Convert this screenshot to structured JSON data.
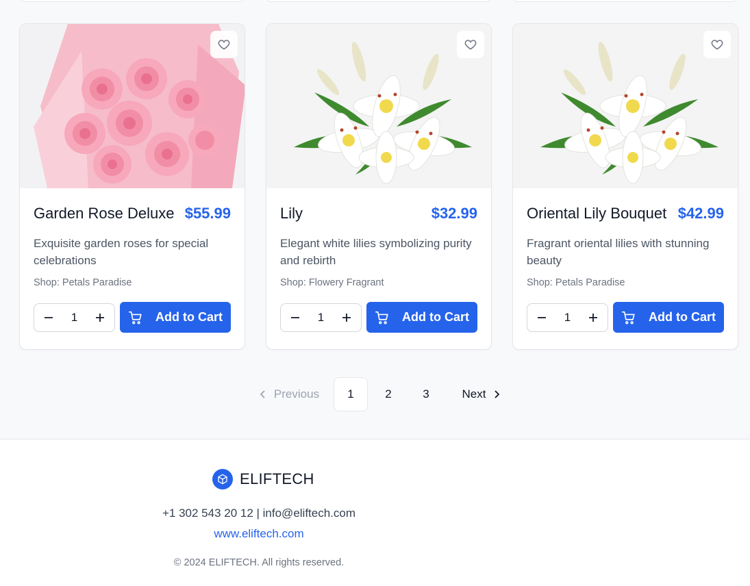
{
  "products": [
    {
      "name": "Garden Rose Deluxe",
      "price": "$55.99",
      "description": "Exquisite garden roses for special celebrations",
      "shop": "Shop: Petals Paradise",
      "quantity": "1",
      "add_label": "Add to Cart",
      "image": "pink-rose-bouquet"
    },
    {
      "name": "Lily",
      "price": "$32.99",
      "description": "Elegant white lilies symbolizing purity and rebirth",
      "shop": "Shop: Flowery Fragrant",
      "quantity": "1",
      "add_label": "Add to Cart",
      "image": "white-lily-bouquet"
    },
    {
      "name": "Oriental Lily Bouquet",
      "price": "$42.99",
      "description": "Fragrant oriental lilies with stunning beauty",
      "shop": "Shop: Petals Paradise",
      "quantity": "1",
      "add_label": "Add to Cart",
      "image": "white-lily-bouquet"
    }
  ],
  "pagination": {
    "previous": "Previous",
    "pages": [
      "1",
      "2",
      "3"
    ],
    "current": "1",
    "next": "Next"
  },
  "footer": {
    "brand": "ELIFTECH",
    "contact": "+1 302 543 20 12 | info@eliftech.com",
    "website": "www.eliftech.com",
    "copyright": "© 2024 ELIFTECH. All rights reserved."
  },
  "colors": {
    "accent": "#2563eb",
    "background": "#f8f9fb",
    "card": "#ffffff"
  },
  "icons": [
    "heart-icon",
    "minus-icon",
    "plus-icon",
    "cart-icon",
    "chevron-left-icon",
    "chevron-right-icon",
    "box-icon"
  ]
}
